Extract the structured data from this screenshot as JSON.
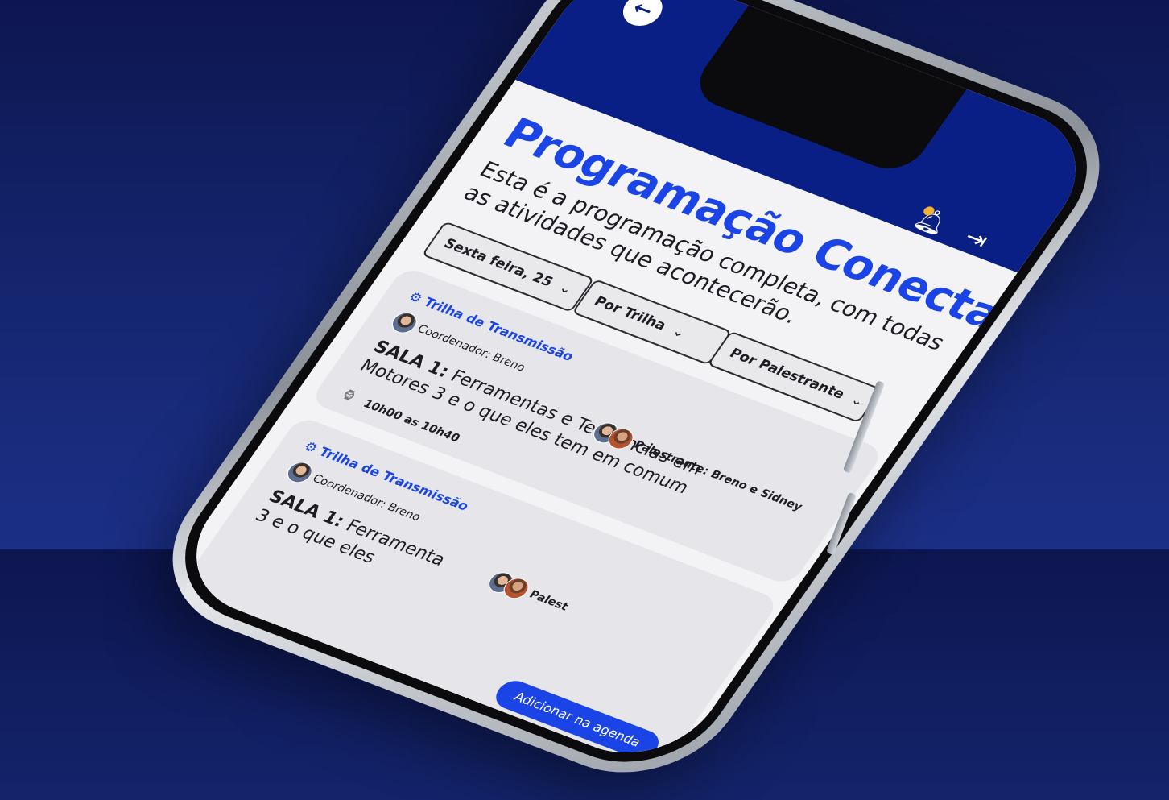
{
  "header": {
    "back_icon": "arrow-left-icon",
    "notification_icon": "bell-icon",
    "logout_icon": "logout-icon"
  },
  "page": {
    "title": "Programação Conecta",
    "subtitle": "Esta é a programação completa, com todas as atividades que acontecerão."
  },
  "filters": {
    "day": "Sexta feira,  25",
    "track": "Por Trilha",
    "speaker": "Por Palestrante"
  },
  "cards": [
    {
      "track": "Trilha de Transmissão",
      "coordinator": "Coordenador: Breno",
      "speaker": "Palestrante: Breno e Sidney",
      "room": "SALA 1:",
      "title": "Ferramentas e Tendências em Motores 3 e o que eles tem em comum",
      "time": "10h00 as 10h40"
    },
    {
      "track": "Trilha de Transmissão",
      "coordinator": "Coordenador: Breno",
      "speaker": "Palest",
      "room": "SALA 1:",
      "title": "Ferramenta",
      "title_line2": "3 e o que eles",
      "add_button": "Adicionar na agenda"
    }
  ],
  "colors": {
    "accent": "#1a44e6",
    "header": "#0a1f85",
    "background_top": "#0d1650",
    "background_bottom": "#1b2f86"
  }
}
